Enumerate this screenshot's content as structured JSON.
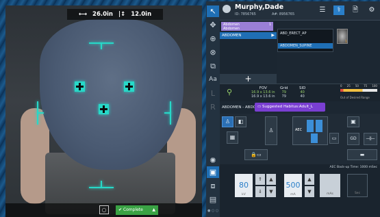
{
  "camera": {
    "width_readout": "26.0in",
    "height_readout": "12.0in",
    "width_icon": "width-arrows-icon",
    "height_icon": "height-arrows-icon"
  },
  "toolbar": {
    "items": [
      "pointer-icon",
      "move-icon",
      "zoom-icon",
      "zoom-alt-icon",
      "copy-icon",
      "rotate-icon",
      "text-icon",
      "l-marker-icon",
      "r-marker-icon",
      "aec-icon",
      "star-icon",
      "sun-icon",
      "video-icon",
      "display-icon",
      "screen-icon"
    ],
    "letters": {
      "text": "Aa",
      "left": "L",
      "right": "R"
    }
  },
  "patient": {
    "name": "Murphy,Dade",
    "id_line": "ID: 7856765",
    "acc_line": "A#: 8956765"
  },
  "procedures": {
    "selected_label_line1": "Abdomen",
    "selected_label_line2": "Abdomen",
    "selected_count": "1",
    "item": "ABDOMEN",
    "sub_items": [
      "ABD_ERECT_AP",
      "ABDOMEN_SUPINE"
    ],
    "thumbnail_count": "1"
  },
  "params": {
    "fov_label": "FOV",
    "fov_line1": "16.9 x 13.6 in",
    "fov_line2": "16.9 x 13.6 in",
    "grid_label": "Grid",
    "grid_line1": "79",
    "grid_line2": "79",
    "sid_label": "SID",
    "sid_line1": "40",
    "sid_line2": "40",
    "gauge_ticks": [
      "0",
      "25",
      "50",
      "75",
      "100"
    ],
    "gauge_caption": "Out of Desired Range"
  },
  "habitus": {
    "name": "ABDOMEN - ABDOM",
    "suggestion": "Suggested Habitus:Adult_L"
  },
  "technique": {
    "backup_time": "AEC Back-up Time: 1000 mSec",
    "kv_value": "80",
    "kv_unit": "kV",
    "ma_value": "500",
    "ma_unit": "mA",
    "mas_unit": "mAs",
    "sec_unit": "Sec",
    "aec_label": "AEC"
  },
  "footer": {
    "complete": "Complete"
  },
  "colors": {
    "accent_blue": "#1f6fb5",
    "purple": "#7a3fd2",
    "complete_green": "#3aa244",
    "overlay_cyan": "#27d8c8"
  }
}
